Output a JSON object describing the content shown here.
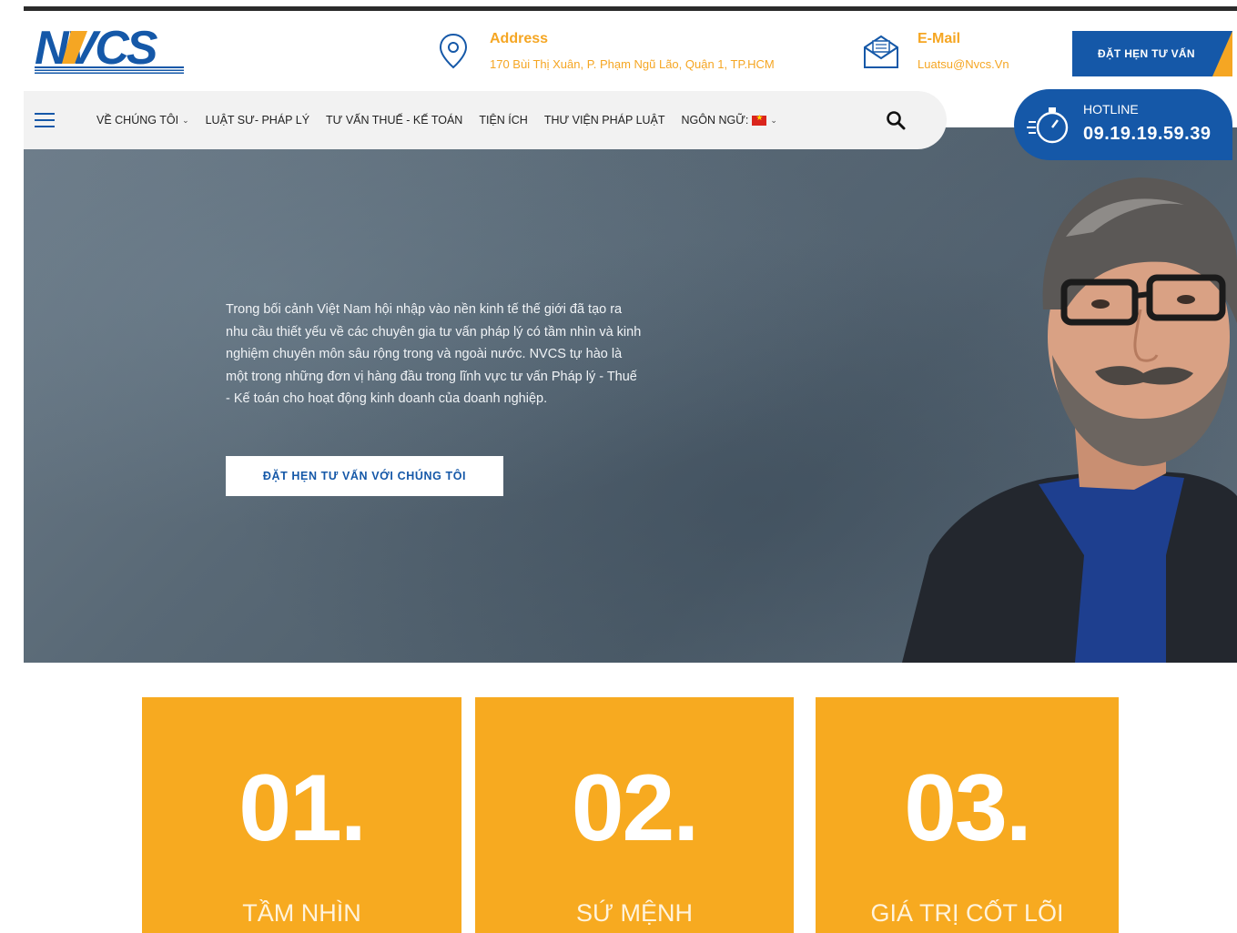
{
  "header": {
    "logo_text": "NVCS",
    "address_label": "Address",
    "address_value": "170 Bùi Thị Xuân, P. Phạm Ngũ Lão, Quận 1, TP.HCM",
    "email_label": "E-Mail",
    "email_value": "Luatsu@Nvcs.Vn",
    "appointment_label": "ĐẶT HẸN TƯ VẤN"
  },
  "nav": {
    "items": [
      {
        "label": "VỀ CHÚNG TÔI",
        "has_dropdown": true
      },
      {
        "label": "LUẬT SƯ- PHÁP LÝ",
        "has_dropdown": false
      },
      {
        "label": "TƯ VẤN THUẾ - KẾ TOÁN",
        "has_dropdown": false
      },
      {
        "label": "TIỆN ÍCH",
        "has_dropdown": false
      },
      {
        "label": "THƯ VIỆN PHÁP LUẬT",
        "has_dropdown": false
      },
      {
        "label": "NGÔN NGỮ:",
        "has_dropdown": true
      }
    ]
  },
  "hotline": {
    "label": "HOTLINE",
    "number": "09.19.19.59.39"
  },
  "hero": {
    "text": "Trong bối cảnh Việt Nam hội nhập vào nền kinh tế thế giới đã tạo ra nhu cầu thiết yếu về các chuyên gia tư vấn pháp lý có tầm nhìn và kinh nghiệm chuyên môn sâu rộng trong và ngoài nước. NVCS tự hào là một trong những đơn vị hàng đầu trong lĩnh vực tư vấn Pháp lý - Thuế - Kế toán cho hoạt động kinh doanh của doanh nghiệp.",
    "cta_label": "ĐẶT HẸN TƯ VẤN VỚI CHÚNG TÔI"
  },
  "cards": [
    {
      "number": "01.",
      "title": "TẦM NHÌN"
    },
    {
      "number": "02.",
      "title": "SỨ MỆNH"
    },
    {
      "number": "03.",
      "title": "GIÁ TRỊ CỐT LÕI"
    }
  ],
  "colors": {
    "brand_blue": "#1558a8",
    "accent_orange": "#f7aa20",
    "label_orange": "#f5a623"
  }
}
